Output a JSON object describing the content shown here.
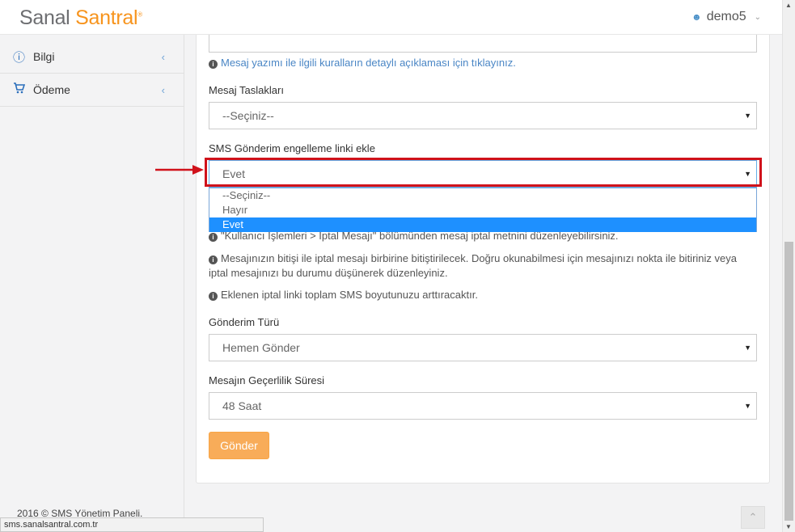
{
  "header": {
    "logo_part1": "Sanal",
    "logo_part2": "Santral",
    "logo_mark": "®",
    "user_name": "demo5"
  },
  "sidebar": {
    "items": [
      {
        "label": "Bilgi",
        "icon": "info-circle-icon"
      },
      {
        "label": "Ödeme",
        "icon": "cart-icon"
      }
    ],
    "footer": "2016 © SMS Yönetim Paneli."
  },
  "status_bar": "sms.sanalsantral.com.tr",
  "form": {
    "rules_link": "Mesaj yazımı ile ilgili kuralların detaylı açıklaması için tıklayınız.",
    "templates": {
      "label": "Mesaj Taslakları",
      "value": "--Seçiniz--"
    },
    "unsubscribe": {
      "label": "SMS Gönderim engelleme linki ekle",
      "value": "Evet",
      "options": [
        "--Seçiniz--",
        "Hayır",
        "Evet"
      ],
      "selected": "Evet"
    },
    "notes": [
      "\"Kullanıcı İşlemleri > İptal Mesajı\" bölümünden mesaj iptal metnini düzenleyebilirsiniz.",
      "Mesajınızın bitişi ile iptal mesajı birbirine bitiştirilecek. Doğru okunabilmesi için mesajınızı nokta ile bitiriniz veya iptal mesajınızı bu durumu düşünerek düzenleyiniz.",
      "Eklenen iptal linki toplam SMS boyutunuzu arttıracaktır."
    ],
    "send_type": {
      "label": "Gönderim Türü",
      "value": "Hemen Gönder"
    },
    "validity": {
      "label": "Mesajın Geçerlilik Süresi",
      "value": "48 Saat"
    },
    "submit_label": "Gönder"
  },
  "colors": {
    "accent": "#f8ac59",
    "highlight": "#d0121b",
    "selected_option": "#1e90ff",
    "link": "#4a86c5"
  }
}
